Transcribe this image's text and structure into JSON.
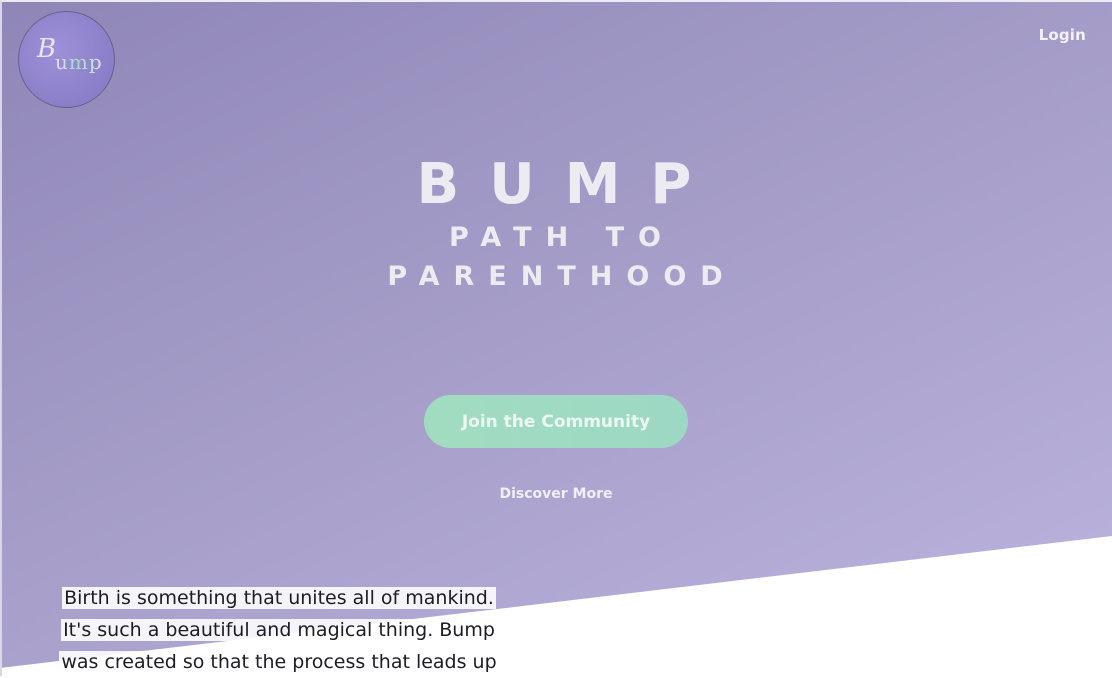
{
  "header": {
    "logo_text": "ump",
    "logo_glyph": "B",
    "login_label": "Login"
  },
  "hero": {
    "title": "BUMP",
    "subtitle_line1": "PATH TO",
    "subtitle_line2": "PARENTHOOD",
    "cta_label": "Join the Community",
    "secondary_label": "Discover More"
  },
  "intro": {
    "text": "Birth is something that unites all of mankind. It's such a beautiful and magical thing. Bump was created so that the process that leads up"
  },
  "colors": {
    "hero_gradient_start": "#8f86b7",
    "hero_gradient_end": "#bdb4e0",
    "cta_accent": "#a2dcc0",
    "logo_circle": "#8a7fc8",
    "heading_text": "#ecebf2"
  }
}
